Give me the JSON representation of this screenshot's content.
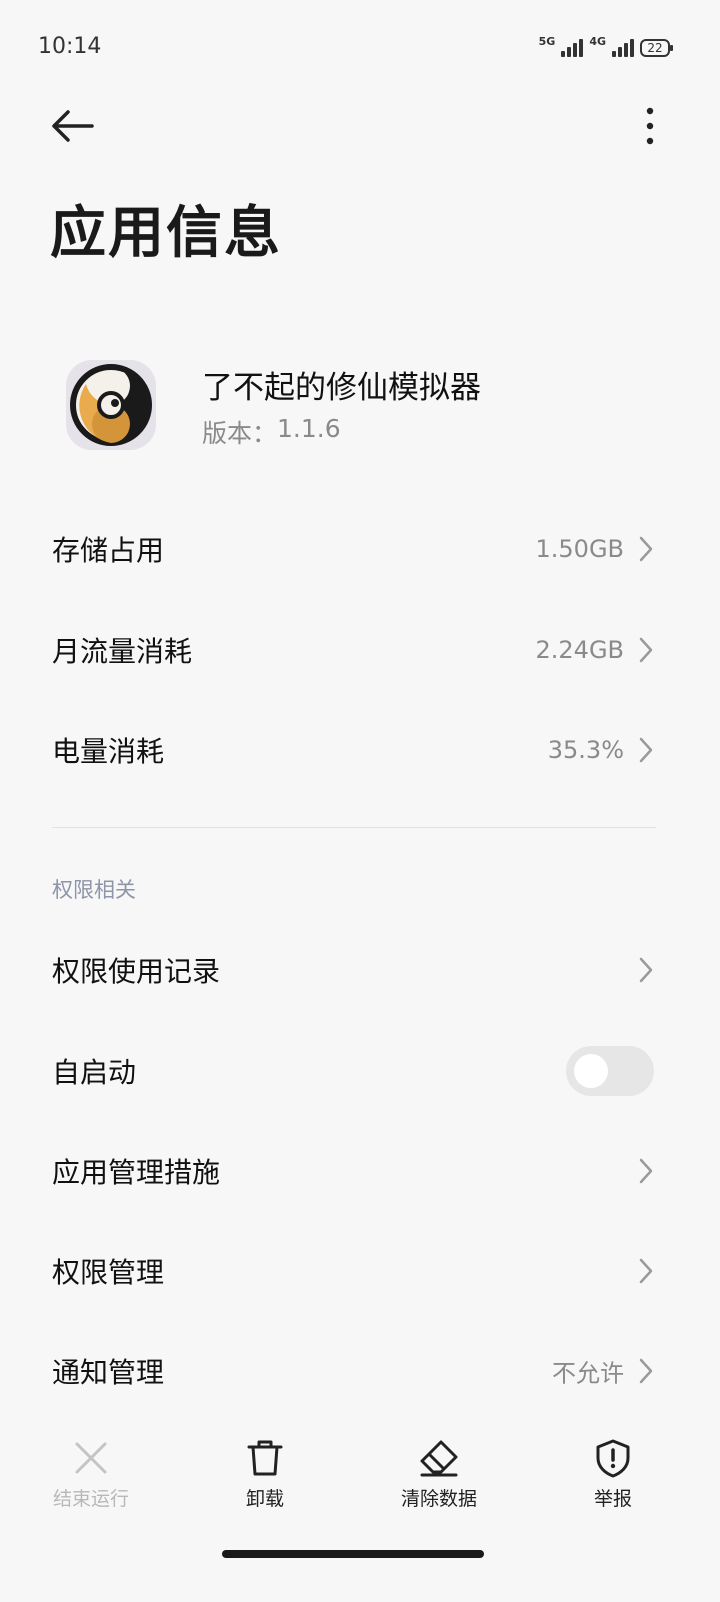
{
  "status_bar": {
    "time": "10:14",
    "network_1": "5G",
    "network_2": "4G",
    "battery_level": "22"
  },
  "header": {
    "title": "应用信息"
  },
  "app": {
    "name": "了不起的修仙模拟器",
    "version_label": "版本：",
    "version": "1.1.6"
  },
  "usage": {
    "storage_label": "存储占用",
    "storage_value": "1.50GB",
    "data_label": "月流量消耗",
    "data_value": "2.24GB",
    "battery_label": "电量消耗",
    "battery_value": "35.3%"
  },
  "permissions": {
    "section_title": "权限相关",
    "record_label": "权限使用记录",
    "autostart_label": "自启动",
    "autostart_on": false,
    "measures_label": "应用管理措施",
    "manage_label": "权限管理",
    "notify_label": "通知管理",
    "notify_value": "不允许"
  },
  "bottom_bar": {
    "stop_label": "结束运行",
    "uninstall_label": "卸载",
    "clear_label": "清除数据",
    "report_label": "举报"
  },
  "colors": {
    "background": "#f7f7f7",
    "secondary_text": "#8a8a8a",
    "section_text": "#8e95a8",
    "disabled_text": "#b8b8b8"
  }
}
